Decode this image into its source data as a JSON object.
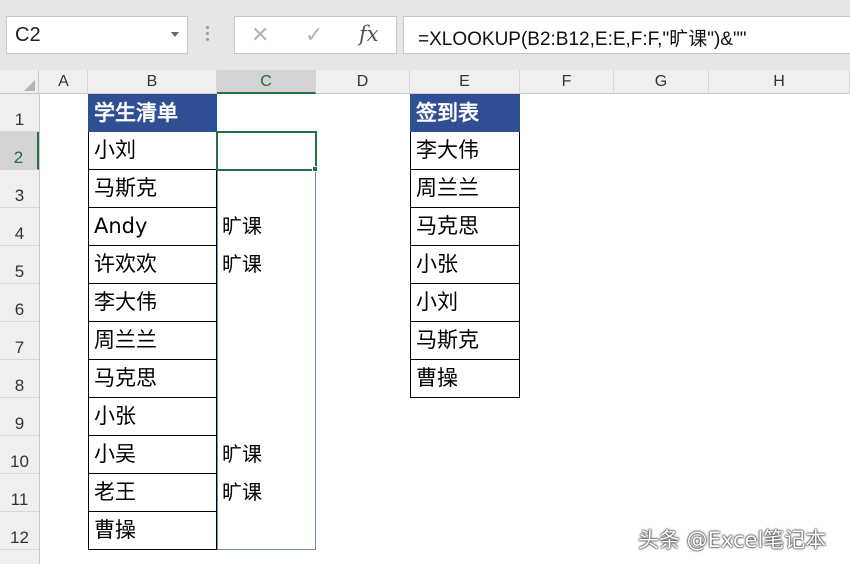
{
  "name_box": "C2",
  "formula": "=XLOOKUP(B2:B12,E:E,F:F,\"旷课\")&\"\"",
  "columns": [
    "A",
    "B",
    "C",
    "D",
    "E",
    "F",
    "G",
    "H"
  ],
  "rows": [
    "1",
    "2",
    "3",
    "4",
    "5",
    "6",
    "7",
    "8",
    "9",
    "10",
    "11",
    "12"
  ],
  "student_list": {
    "header": "学生清单",
    "names": [
      "小刘",
      "马斯克",
      "Andy",
      "许欢欢",
      "李大伟",
      "周兰兰",
      "马克思",
      "小张",
      "小吴",
      "老王",
      "曹操"
    ]
  },
  "result_column": [
    "",
    "",
    "旷课",
    "旷课",
    "",
    "",
    "",
    "",
    "旷课",
    "旷课",
    ""
  ],
  "sign_in": {
    "header": "签到表",
    "names": [
      "李大伟",
      "周兰兰",
      "马克思",
      "小张",
      "小刘",
      "马斯克",
      "曹操"
    ]
  },
  "watermark": "头条 @Excel笔记本",
  "colors": {
    "table_header": "#2f4e93",
    "selection": "#217346"
  }
}
